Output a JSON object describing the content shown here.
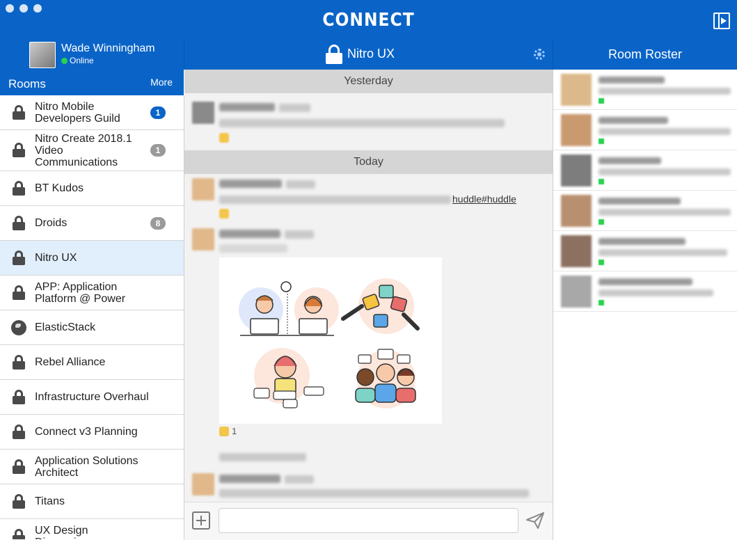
{
  "app": {
    "title": "CONNECT"
  },
  "user": {
    "name": "Wade Winningham",
    "status": "Online"
  },
  "rooms": {
    "title": "Rooms",
    "more_label": "More",
    "items": [
      {
        "label": "Nitro Mobile Developers Guild",
        "badge": "1",
        "icon": "lock-icon"
      },
      {
        "label": "Nitro Create 2018.1 Video Communications",
        "badge": "1",
        "icon": "lock-icon"
      },
      {
        "label": "BT Kudos",
        "badge": "",
        "icon": "lock-icon"
      },
      {
        "label": "Droids",
        "badge": "8",
        "icon": "lock-icon"
      },
      {
        "label": "Nitro UX",
        "badge": "",
        "icon": "lock-icon"
      },
      {
        "label": "APP: Application Platform @ Power",
        "badge": "",
        "icon": "lock-icon"
      },
      {
        "label": "ElasticStack",
        "badge": "",
        "icon": "globe-icon"
      },
      {
        "label": "Rebel Alliance",
        "badge": "",
        "icon": "lock-icon"
      },
      {
        "label": "Infrastructure Overhaul",
        "badge": "",
        "icon": "lock-icon"
      },
      {
        "label": "Connect v3 Planning",
        "badge": "",
        "icon": "lock-icon"
      },
      {
        "label": "Application Solutions Architect",
        "badge": "",
        "icon": "lock-icon"
      },
      {
        "label": "Titans",
        "badge": "",
        "icon": "lock-icon"
      },
      {
        "label": "UX Design Discussions",
        "badge": "",
        "icon": "lock-icon"
      }
    ]
  },
  "chat": {
    "room_title": "Nitro UX",
    "separators": {
      "yesterday": "Yesterday",
      "today": "Today"
    },
    "link_text": "huddle#huddle",
    "reaction_count": "1",
    "composer_placeholder": ""
  },
  "roster": {
    "title": "Room Roster"
  },
  "colors": {
    "brand": "#0a64c8",
    "online": "#29d24f",
    "active_room": "#e1eefc"
  }
}
